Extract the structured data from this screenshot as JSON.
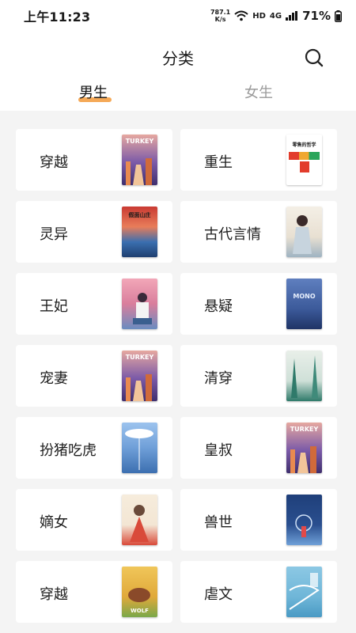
{
  "status_bar": {
    "time": "上午11:23",
    "net_speed_value": "787.1",
    "net_speed_unit": "K/s",
    "hd_label": "HD",
    "network_type": "4G",
    "battery": "71%"
  },
  "header": {
    "title": "分类",
    "search_icon": "search-icon"
  },
  "tabs": [
    {
      "label": "男生",
      "active": true
    },
    {
      "label": "女生",
      "active": false
    }
  ],
  "colors": {
    "accent": "#f39a3a",
    "inactive_tab": "#9a9a9a",
    "background": "#f4f4f4"
  },
  "categories": [
    {
      "label": "穿越",
      "cover": {
        "text": "TURKEY",
        "bg": "#6b4fa0",
        "accent": "#e98a4f"
      }
    },
    {
      "label": "重生",
      "cover": {
        "text": "零售的哲学",
        "bg": "#ffffff",
        "accent": "#e23c2c"
      }
    },
    {
      "label": "灵异",
      "cover": {
        "text": "假面山庄",
        "bg": "#c93a32",
        "accent": "#3a6fb0"
      }
    },
    {
      "label": "古代言情",
      "cover": {
        "text": "",
        "bg": "#f1ece3",
        "accent": "#8aa3b8"
      }
    },
    {
      "label": "王妃",
      "cover": {
        "text": "",
        "bg": "#d97e9c",
        "accent": "#3a5f8f"
      }
    },
    {
      "label": "悬疑",
      "cover": {
        "text": "MONO",
        "bg": "#3c5a9a",
        "accent": "#d8e2f2"
      }
    },
    {
      "label": "宠妻",
      "cover": {
        "text": "TURKEY",
        "bg": "#6b4fa0",
        "accent": "#e98a4f"
      }
    },
    {
      "label": "清穿",
      "cover": {
        "text": "",
        "bg": "#dfe8e4",
        "accent": "#2f7a6a"
      }
    },
    {
      "label": "扮猪吃虎",
      "cover": {
        "text": "",
        "bg": "#6f9fd8",
        "accent": "#ffffff"
      }
    },
    {
      "label": "皇叔",
      "cover": {
        "text": "TURKEY",
        "bg": "#6b4fa0",
        "accent": "#e98a4f"
      }
    },
    {
      "label": "嫡女",
      "cover": {
        "text": "",
        "bg": "#f3e6d4",
        "accent": "#d94a3a"
      }
    },
    {
      "label": "兽世",
      "cover": {
        "text": "",
        "bg": "#2a4f8f",
        "accent": "#e24a4a"
      }
    },
    {
      "label": "穿越",
      "cover": {
        "text": "WOLF",
        "bg": "#e0a93a",
        "accent": "#6a3a1a"
      }
    },
    {
      "label": "虐文",
      "cover": {
        "text": "",
        "bg": "#6fb6d8",
        "accent": "#ffffff"
      }
    }
  ]
}
